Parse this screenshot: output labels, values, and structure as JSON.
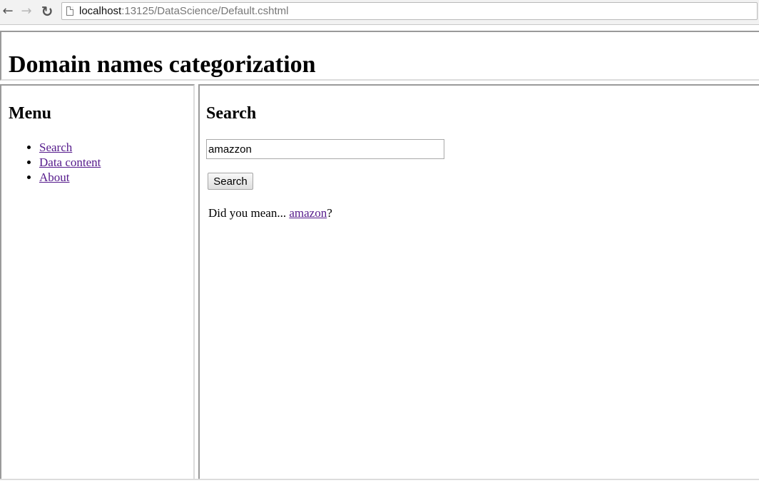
{
  "browser": {
    "url_host": "localhost",
    "url_path": ":13125/DataScience/Default.cshtml",
    "back_icon": "back-arrow-icon",
    "forward_icon": "forward-arrow-icon",
    "reload_icon": "reload-icon"
  },
  "header": {
    "title": "Domain names categorization"
  },
  "sidebar": {
    "title": "Menu",
    "items": [
      {
        "label": "Search"
      },
      {
        "label": "Data content"
      },
      {
        "label": "About"
      }
    ]
  },
  "main": {
    "title": "Search",
    "search_value": "amazzon",
    "search_button_label": "Search",
    "suggestion_prefix": "Did you mean... ",
    "suggestion_link": "amazon",
    "suggestion_suffix": "?"
  },
  "colors": {
    "visited_link": "#551a8b",
    "border_dark": "#9a9a9a",
    "border_light": "#dcdcdc"
  }
}
